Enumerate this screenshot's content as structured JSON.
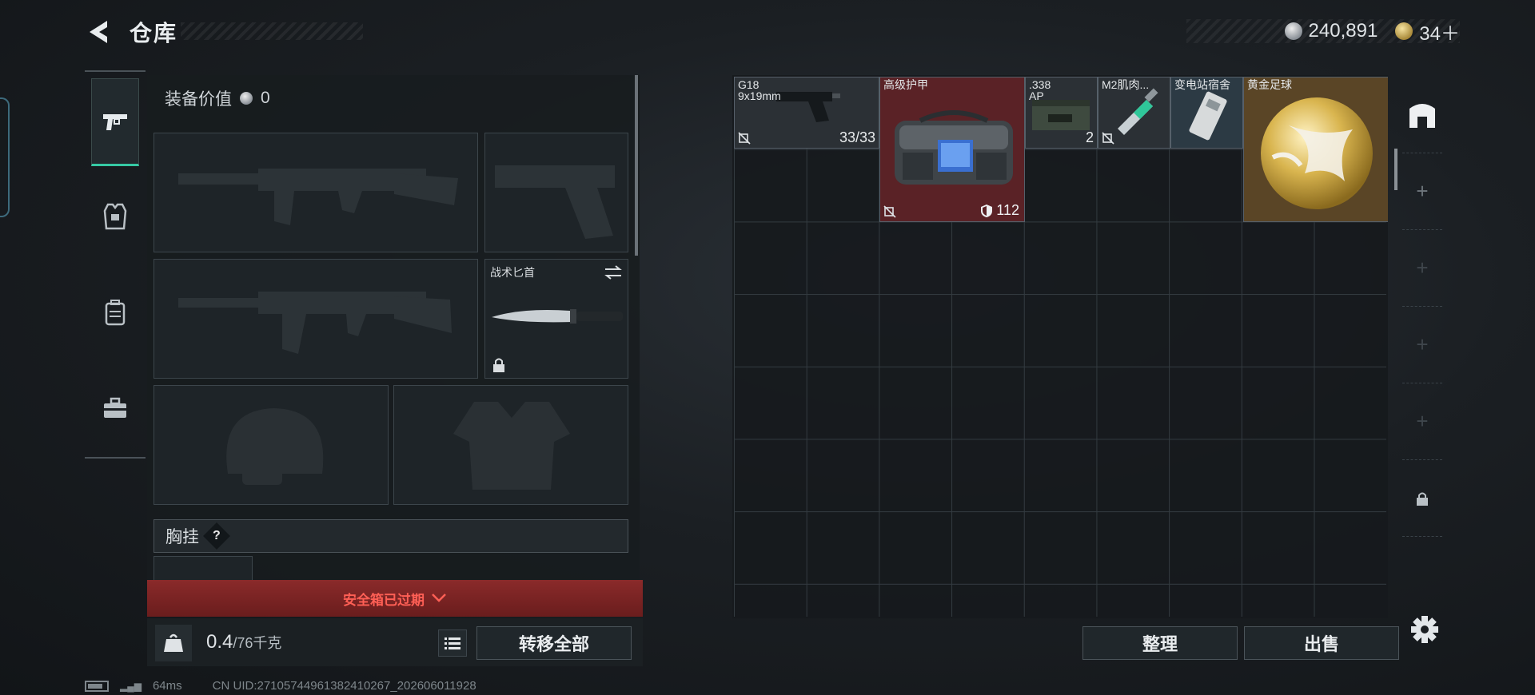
{
  "header": {
    "title": "仓库",
    "back_icon": "back-arrow-icon",
    "currency": {
      "silver": "240,891",
      "gold": "34＋"
    }
  },
  "categories": [
    {
      "id": "weapons",
      "icon": "pistol-icon",
      "active": true
    },
    {
      "id": "armor",
      "icon": "armor-vest-icon",
      "active": false
    },
    {
      "id": "backpack",
      "icon": "backpack-icon",
      "active": false
    },
    {
      "id": "case",
      "icon": "briefcase-icon",
      "active": false
    }
  ],
  "loadout": {
    "equip_value_label": "装备价值",
    "equip_value": "0",
    "melee_label": "战术匕首",
    "chest_label": "胸挂",
    "chest_help": "?",
    "safe_box_expired": "安全箱已过期",
    "weight_current": "0.4",
    "weight_max": "/76千克",
    "transfer_all": "转移全部"
  },
  "stash": {
    "items": [
      {
        "name": "G18\n9x19mm",
        "count": "33/33",
        "icon": "pistol-icon",
        "bg": "#2b3035"
      },
      {
        "name": "高级护甲",
        "durability": "112",
        "icon": "armor-bag-icon",
        "bg": "#5a2226"
      },
      {
        "name": ".338\nAP",
        "count": "2",
        "icon": "ammo-box-icon",
        "bg": "#2b3035"
      },
      {
        "name": "M2肌肉...",
        "icon": "syringe-icon",
        "bg": "#2b3035"
      },
      {
        "name": "变电站宿舍",
        "icon": "keycard-icon",
        "bg": "#2c3a44"
      },
      {
        "name": "黄金足球",
        "icon": "golden-ball-icon",
        "bg": "#5a4526"
      }
    ],
    "sort_button": "整理",
    "sell_button": "出售"
  },
  "side_rail": {
    "top_icon": "container-icon",
    "add_symbol": "+",
    "lock_icon": "lock-icon",
    "settings_icon": "gear-icon"
  },
  "footer": {
    "ping": "64ms",
    "uid": "CN UID:27105744961382410267_202606011928"
  }
}
